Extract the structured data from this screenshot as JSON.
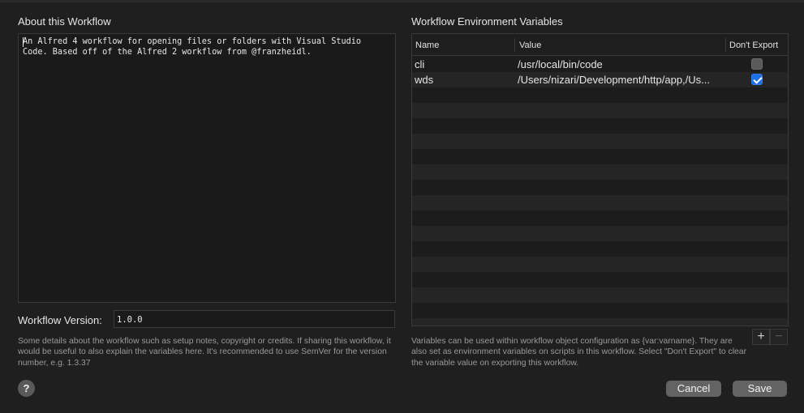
{
  "about": {
    "title": "About this Workflow",
    "text": "An Alfred 4 workflow for opening files or folders with Visual Studio\nCode. Based off of the Alfred 2 workflow from @franzheidl.",
    "version_label": "Workflow Version:",
    "version_value": "1.0.0",
    "help": "Some details about the workflow such as setup notes, copyright or credits. If sharing this workflow, it would be useful to also explain the variables here. It's recommended to use SemVer for the version number, e.g. 1.3.37"
  },
  "env": {
    "title": "Workflow Environment Variables",
    "columns": {
      "name": "Name",
      "value": "Value",
      "dont_export": "Don't Export"
    },
    "rows": [
      {
        "name": "cli",
        "value": "/usr/local/bin/code",
        "dont_export": false
      },
      {
        "name": "wds",
        "value": "/Users/nizari/Development/http/app,/Us...",
        "dont_export": true
      }
    ],
    "add_label": "+",
    "remove_label": "−",
    "help": "Variables can be used within workflow object configuration as {var:varname}. They are also set as environment variables on scripts in this workflow. Select \"Don't Export\" to clear the variable value on exporting this workflow."
  },
  "footer": {
    "help_label": "?",
    "cancel_label": "Cancel",
    "save_label": "Save"
  },
  "colors": {
    "background": "#1f1f1f",
    "checkbox_checked": "#1f6fe6",
    "button": "#636363"
  }
}
